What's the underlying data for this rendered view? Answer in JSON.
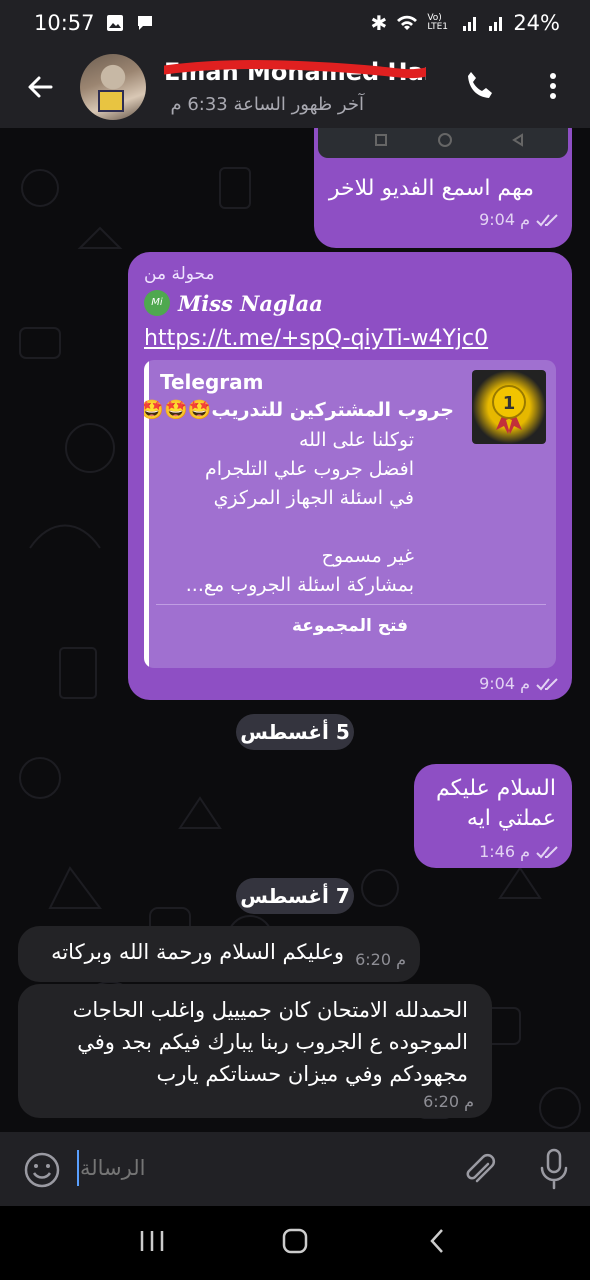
{
  "status_bar": {
    "time": "10:57",
    "battery": "24%",
    "network_label": "Vo) LTE1"
  },
  "header": {
    "contact_name": "Eman Mohamed Ham",
    "last_seen": "آخر ظهور الساعة 6:33 م"
  },
  "messages": [
    {
      "direction": "out",
      "text": "مهم اسمع الفديو للاخر",
      "time": "9:04 م"
    },
    {
      "direction": "out",
      "forwarded_label": "محولة من",
      "forwarded_from": "Miss Naglaa",
      "link": "https://t.me/+spQ-qiyTi-w4Yjc0",
      "preview": {
        "site": "Telegram",
        "title": "جروب المشتركين للتدريب🤩🤩🤩",
        "description_lines": [
          "توكلنا على الله",
          "افضل جروب علي التلجرام",
          "في اسئلة الجهاز المركزي",
          "",
          "غير مسموح",
          "بمشاركة اسئلة  الجروب مع..."
        ],
        "action": "فتح المجموعة"
      },
      "time": "9:04 م"
    },
    {
      "type": "date",
      "text": "5 أغسطس"
    },
    {
      "direction": "out",
      "lines": [
        "السلام عليكم",
        "عملتي ايه"
      ],
      "time": "1:46 م"
    },
    {
      "type": "date",
      "text": "7 أغسطس"
    },
    {
      "direction": "in",
      "text": "وعليكم السلام ورحمة الله وبركاته",
      "time": "6:20 م"
    },
    {
      "direction": "in",
      "lines": [
        "الحمدلله الامتحان كان جميييل واغلب الحاجات",
        "الموجوده ع الجروب ربنا يبارك فيكم بجد وفي",
        "مجهودكم وفي ميزان حسناتكم يارب"
      ],
      "time": "6:20 م"
    }
  ],
  "input": {
    "placeholder": "الرسالة"
  },
  "icons": {
    "back": "arrow-left-icon",
    "call": "phone-icon",
    "more": "more-vertical-icon",
    "emoji": "emoji-icon",
    "attach": "paperclip-icon",
    "mic": "microphone-icon"
  },
  "colors": {
    "outgoing_bubble": "#8e4fc4",
    "incoming_bubble": "#232326",
    "header_bg": "#212125"
  }
}
